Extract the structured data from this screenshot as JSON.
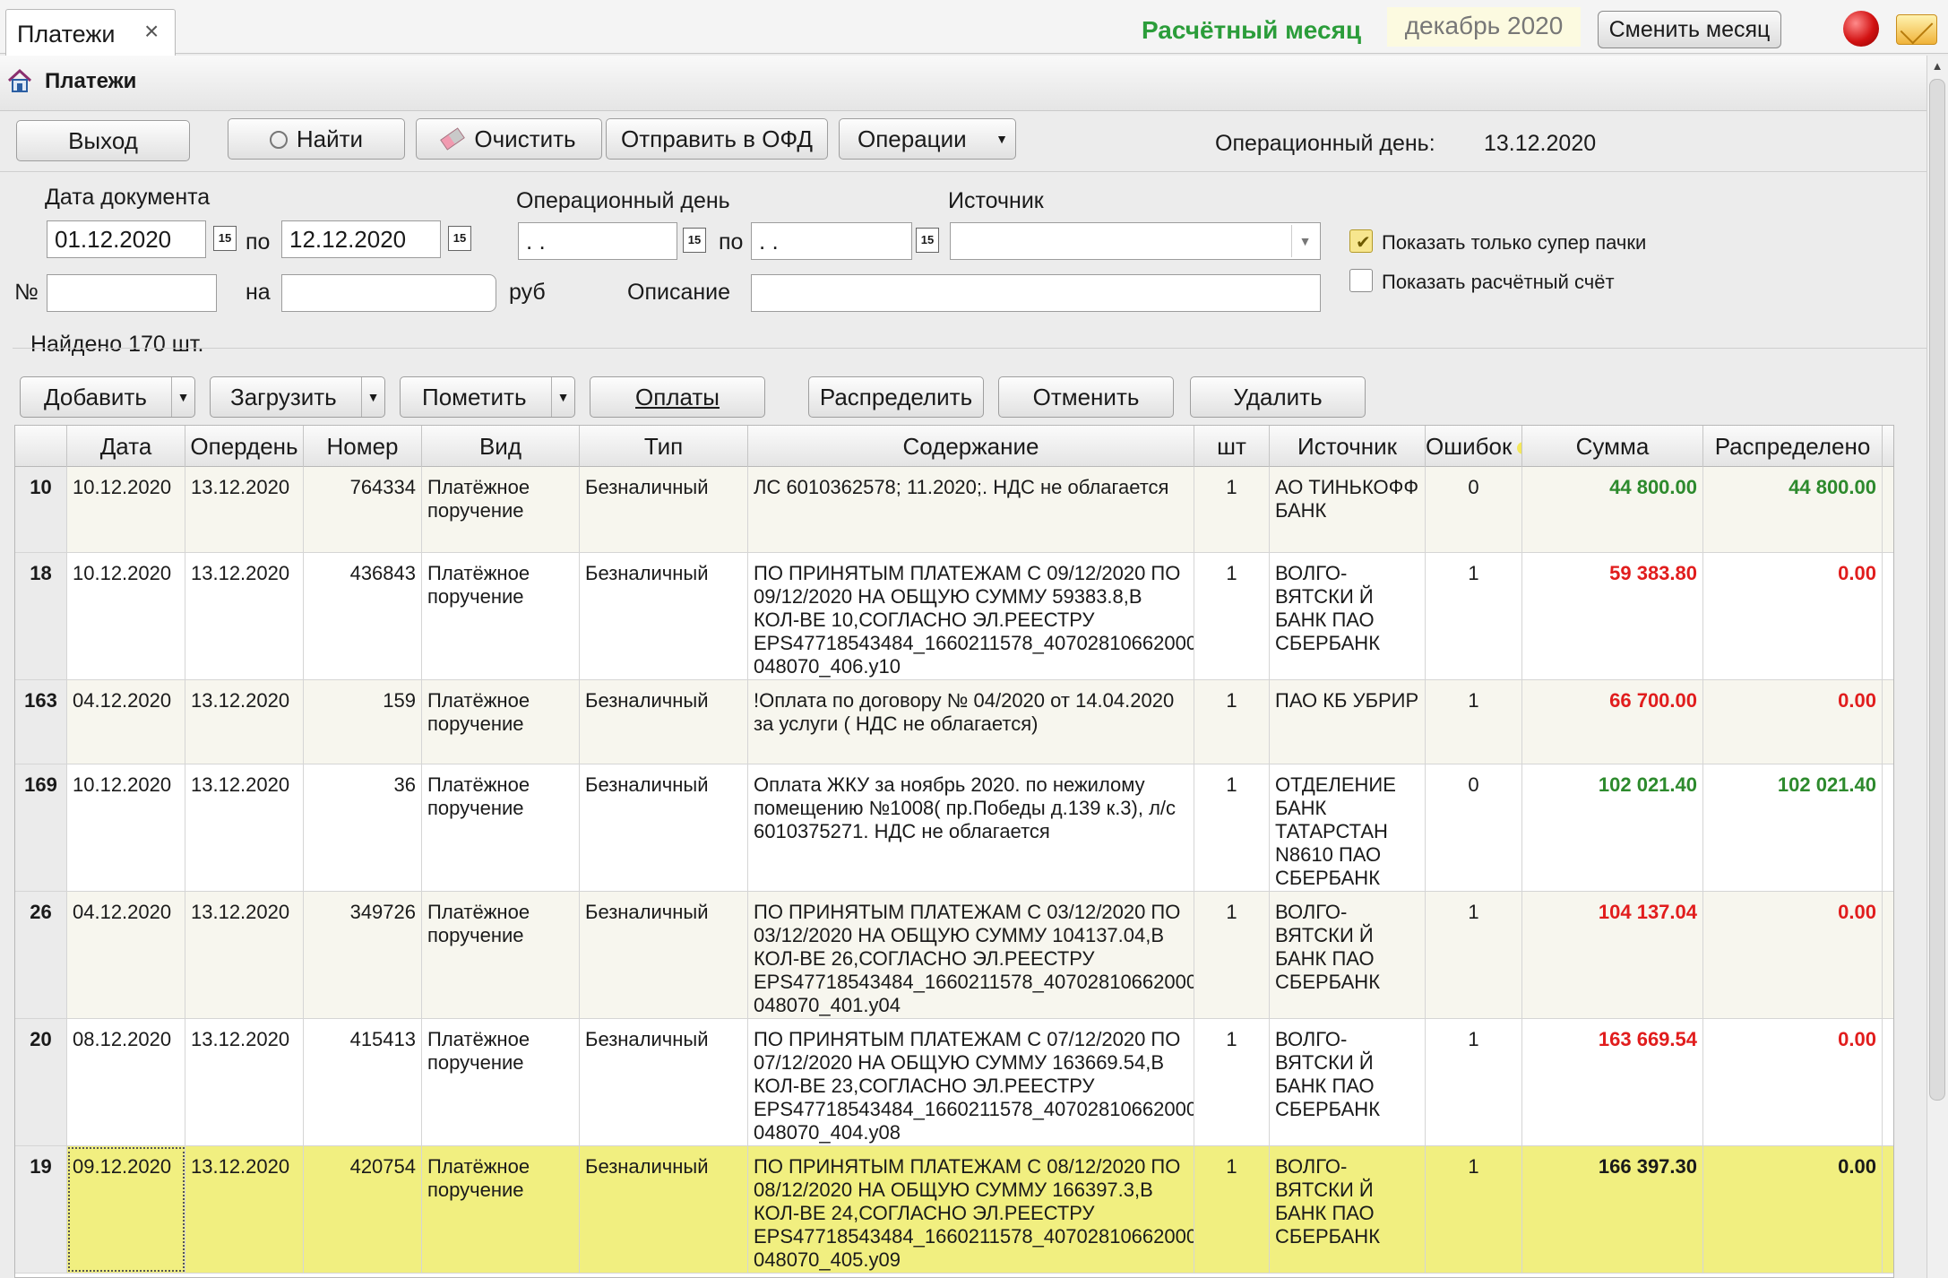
{
  "tabbar": {
    "tab_label": "Платежи",
    "close_glyph": "×",
    "month_label": "Расчётный месяц",
    "month_value": "декабрь 2020",
    "change_month_button": "Сменить месяц"
  },
  "header": {
    "title": "Платежи",
    "icon": "home-icon"
  },
  "toolbar1": {
    "exit": "Выход",
    "find": "Найти",
    "clear": "Очистить",
    "send_ofd": "Отправить в ОФД",
    "operations": "Операции",
    "op_day_label": "Операционный день:",
    "op_day_value": "13.12.2020"
  },
  "filters": {
    "doc_date_label": "Дата документа",
    "doc_date_from": "01.12.2020",
    "to_label": "по",
    "doc_date_to": "12.12.2020",
    "op_day_label": "Операционный день",
    "op_day_from": " .  .",
    "op_day_to": " .  .",
    "source_label": "Источник",
    "source_value": "",
    "number_label": "№",
    "number_value": "",
    "amount_on_label": "на",
    "amount_value": "",
    "rub_label": "руб",
    "description_label": "Описание",
    "description_value": "",
    "show_super_label": "Показать только супер пачки",
    "show_super_checked": true,
    "show_account_label": "Показать расчётный счёт",
    "show_account_checked": false,
    "calendar_glyph": "15"
  },
  "found": "Найдено 170 шт.",
  "toolbar2": {
    "add": "Добавить",
    "load": "Загрузить",
    "mark": "Пометить",
    "payments": "Оплаты",
    "distribute": "Распределить",
    "cancel": "Отменить",
    "delete": "Удалить"
  },
  "grid": {
    "columns": [
      "",
      "Дата",
      "Опердень",
      "Номер",
      "Вид",
      "Тип",
      "Содержание",
      "шт",
      "Источник",
      "Ошибок",
      "Сумма",
      "Распределено"
    ],
    "errors_hint_badge": "1",
    "rows": [
      {
        "n": "10",
        "date": "10.12.2020",
        "opday": "13.12.2020",
        "num": "764334",
        "kind": "Платёжное поручение",
        "type": "Безналичный",
        "content": "ЛС 6010362578; 11.2020;. НДС не облагается",
        "qty": "1",
        "source": "АО  ТИНЬКОФФ БАНК",
        "errors": "0",
        "sum": "44 800.00",
        "sum_color": "green",
        "dist": "44 800.00",
        "dist_color": "green"
      },
      {
        "n": "18",
        "date": "10.12.2020",
        "opday": "13.12.2020",
        "num": "436843",
        "kind": "Платёжное поручение",
        "type": "Безналичный",
        "content": "ПО ПРИНЯТЫМ ПЛАТЕЖАМ С 09/12/2020 ПО 09/12/2020 НА ОБЩУЮ СУММУ 59383.8,В КОЛ-ВЕ 10,СОГЛАСНО ЭЛ.РЕЕСТРУ EPS47718543484_1660211578_40702810662000 048070_406.y10",
        "qty": "1",
        "source": "ВОЛГО-ВЯТСКИ Й БАНК ПАО СБЕРБАНК",
        "errors": "1",
        "sum": "59 383.80",
        "sum_color": "red",
        "dist": "0.00",
        "dist_color": "red"
      },
      {
        "n": "163",
        "date": "04.12.2020",
        "opday": "13.12.2020",
        "num": "159",
        "kind": "Платёжное поручение",
        "type": "Безналичный",
        "content": "!Оплата по договору № 04/2020 от 14.04.2020 за услуги ( НДС не облагается)",
        "qty": "1",
        "source": "ПАО КБ  УБРИР",
        "errors": "1",
        "sum": "66 700.00",
        "sum_color": "red",
        "dist": "0.00",
        "dist_color": "red"
      },
      {
        "n": "169",
        "date": "10.12.2020",
        "opday": "13.12.2020",
        "num": "36",
        "kind": "Платёжное поручение",
        "type": "Безналичный",
        "content": "Оплата ЖКУ за ноябрь 2020. по нежилому помещению №1008( пр.Победы д.139 к.3), л/с 6010375271. НДС не облагается",
        "qty": "1",
        "source": "ОТДЕЛЕНИЕ БАНК ТАТАРСТАН N8610 ПАО СБЕРБАНК",
        "errors": "0",
        "sum": "102 021.40",
        "sum_color": "green",
        "dist": "102 021.40",
        "dist_color": "green"
      },
      {
        "n": "26",
        "date": "04.12.2020",
        "opday": "13.12.2020",
        "num": "349726",
        "kind": "Платёжное поручение",
        "type": "Безналичный",
        "content": "ПО ПРИНЯТЫМ ПЛАТЕЖАМ С 03/12/2020 ПО 03/12/2020 НА ОБЩУЮ СУММУ 104137.04,В КОЛ-ВЕ 26,СОГЛАСНО ЭЛ.РЕЕСТРУ EPS47718543484_1660211578_40702810662000 048070_401.y04",
        "qty": "1",
        "source": "ВОЛГО-ВЯТСКИ Й БАНК ПАО СБЕРБАНК",
        "errors": "1",
        "sum": "104 137.04",
        "sum_color": "red",
        "dist": "0.00",
        "dist_color": "red"
      },
      {
        "n": "20",
        "date": "08.12.2020",
        "opday": "13.12.2020",
        "num": "415413",
        "kind": "Платёжное поручение",
        "type": "Безналичный",
        "content": "ПО ПРИНЯТЫМ ПЛАТЕЖАМ С 07/12/2020 ПО 07/12/2020 НА ОБЩУЮ СУММУ 163669.54,В КОЛ-ВЕ 23,СОГЛАСНО ЭЛ.РЕЕСТРУ EPS47718543484_1660211578_40702810662000 048070_404.y08",
        "qty": "1",
        "source": "ВОЛГО-ВЯТСКИ Й БАНК ПАО СБЕРБАНК",
        "errors": "1",
        "sum": "163 669.54",
        "sum_color": "red",
        "dist": "0.00",
        "dist_color": "red"
      },
      {
        "n": "19",
        "date": "09.12.2020",
        "opday": "13.12.2020",
        "num": "420754",
        "kind": "Платёжное поручение",
        "type": "Безналичный",
        "content": "ПО ПРИНЯТЫМ ПЛАТЕЖАМ С 08/12/2020 ПО 08/12/2020 НА ОБЩУЮ СУММУ 166397.3,В КОЛ-ВЕ 24,СОГЛАСНО ЭЛ.РЕЕСТРУ EPS47718543484_1660211578_40702810662000 048070_405.y09",
        "qty": "1",
        "source": "ВОЛГО-ВЯТСКИ Й БАНК ПАО СБЕРБАНК",
        "errors": "1",
        "sum": "166 397.30",
        "sum_color": "black",
        "dist": "0.00",
        "dist_color": "black",
        "selected": true
      }
    ]
  }
}
